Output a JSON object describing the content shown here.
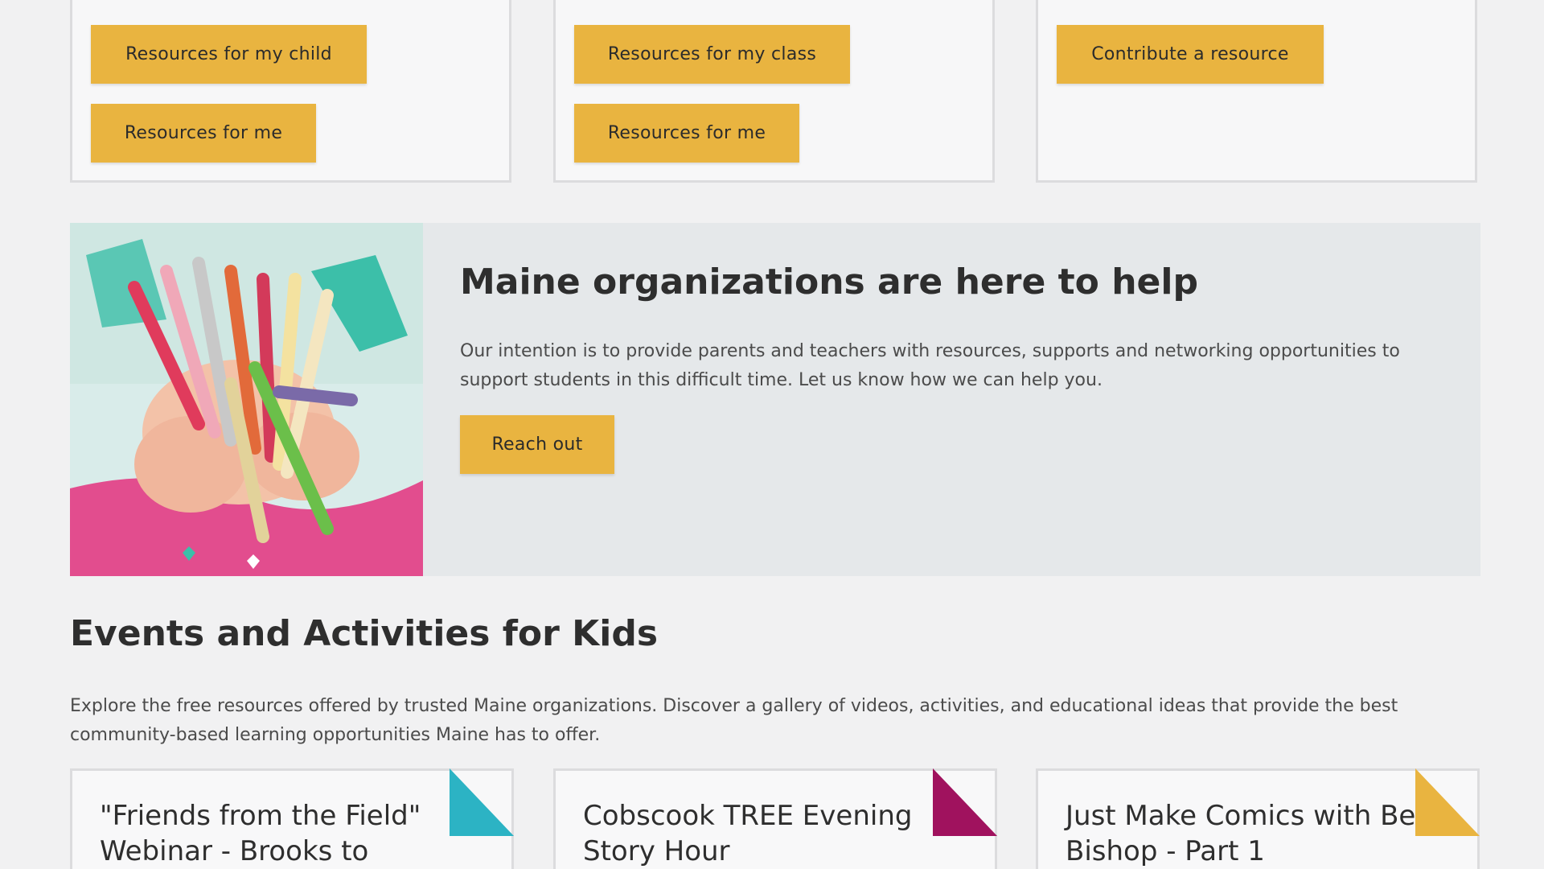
{
  "top_cards": [
    {
      "buttons": [
        "Resources for my child",
        "Resources for me"
      ]
    },
    {
      "buttons": [
        "Resources for my class",
        "Resources for me"
      ]
    },
    {
      "buttons": [
        "Contribute a resource"
      ]
    }
  ],
  "help": {
    "title": "Maine organizations are here to help",
    "body": "Our intention is to provide parents and teachers with resources, supports and networking opportunities to support students in this difficult time. Let us know how we can help you.",
    "button": "Reach out"
  },
  "events": {
    "title": "Events and Activities for Kids",
    "body": "Explore the free resources offered by trusted Maine organizations. Discover a gallery of videos, activities, and educational ideas that provide the best community-based learning opportunities Maine has to offer.",
    "cards": [
      {
        "title": "\"Friends from the Field\" Webinar - Brooks to",
        "accent": "#2cb3c4"
      },
      {
        "title": "Cobscook TREE Evening Story Hour",
        "accent": "#a0125e"
      },
      {
        "title": "Just Make Comics with Ben Bishop - Part 1",
        "accent": "#e9b440"
      }
    ]
  },
  "colors": {
    "button": "#e9b440",
    "help_bg": "#e5e8ea",
    "page_bg": "#f1f1f2"
  }
}
